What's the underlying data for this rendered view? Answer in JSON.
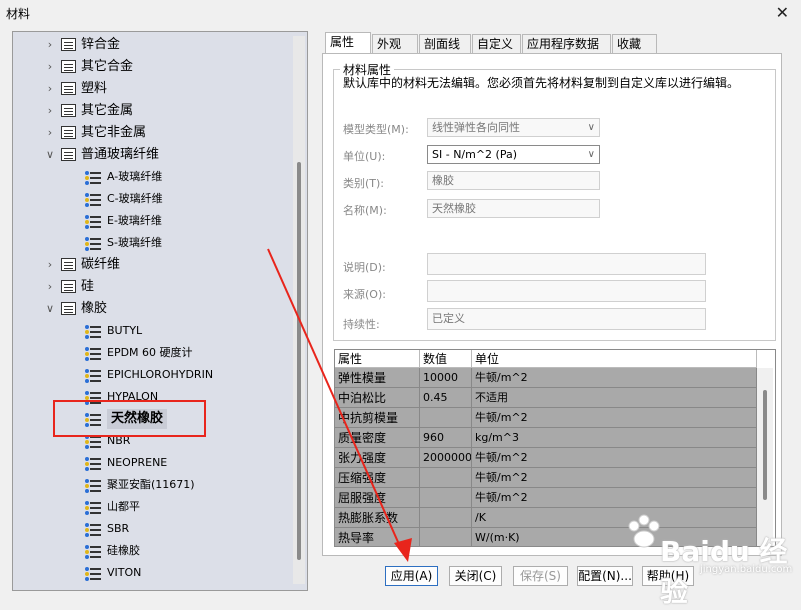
{
  "window": {
    "title": "材料",
    "close_glyph": "✕"
  },
  "tree": {
    "folders": [
      {
        "label": "锌合金",
        "expanded": false
      },
      {
        "label": "其它合金",
        "expanded": false
      },
      {
        "label": "塑料",
        "expanded": false
      },
      {
        "label": "其它金属",
        "expanded": false
      },
      {
        "label": "其它非金属",
        "expanded": false
      },
      {
        "label": "普通玻璃纤维",
        "expanded": true
      },
      {
        "label": "碳纤维",
        "expanded": false
      },
      {
        "label": "硅",
        "expanded": false
      },
      {
        "label": "橡胶",
        "expanded": true
      }
    ],
    "glass_materials": [
      "A-玻璃纤维",
      "C-玻璃纤维",
      "E-玻璃纤维",
      "S-玻璃纤维"
    ],
    "rubber_materials": [
      "BUTYL",
      "EPDM 60 硬度计",
      "EPICHLOROHYDRIN",
      "HYPALON",
      "天然橡胶",
      "NBR",
      "NEOPRENE",
      "聚亚安酯(11671)",
      "山都平",
      "SBR",
      "硅橡胶",
      "VITON"
    ],
    "selected": "天然橡胶",
    "collapse_glyph": "∨",
    "expand_glyph": "›"
  },
  "tabs": [
    "属性",
    "外观",
    "剖面线",
    "自定义",
    "应用程序数据",
    "收藏"
  ],
  "active_tab": "属性",
  "props": {
    "group_title": "材料属性",
    "notice": "默认库中的材料无法编辑。您必须首先将材料复制到自定义库以进行编辑。",
    "model_type_label": "模型类型(M):",
    "model_type_value": "线性弹性各向同性",
    "unit_label": "单位(U):",
    "unit_value": "SI - N/m^2 (Pa)",
    "category_label": "类别(T):",
    "category_value": "橡胶",
    "name_label": "名称(M):",
    "name_value": "天然橡胶",
    "desc_label": "说明(D):",
    "desc_value": "",
    "source_label": "来源(O):",
    "source_value": "",
    "sustain_label": "持续性:",
    "sustain_value": "已定义",
    "dropdown_glyph": "∨"
  },
  "grid": {
    "columns": [
      "属性",
      "数值",
      "单位"
    ],
    "rows": [
      [
        "弹性模量",
        "10000",
        "牛顿/m^2"
      ],
      [
        "中泊松比",
        "0.45",
        "不适用"
      ],
      [
        "中抗剪模量",
        "",
        "牛顿/m^2"
      ],
      [
        "质量密度",
        "960",
        "kg/m^3"
      ],
      [
        "张力强度",
        "20000000",
        "牛顿/m^2"
      ],
      [
        "压缩强度",
        "",
        "牛顿/m^2"
      ],
      [
        "屈服强度",
        "",
        "牛顿/m^2"
      ],
      [
        "热膨胀系数",
        "",
        "/K"
      ],
      [
        "热导率",
        "",
        "W/(m·K)"
      ]
    ]
  },
  "buttons": {
    "apply": "应用(A)",
    "close": "关闭(C)",
    "save": "保存(S)",
    "config": "配置(N)...",
    "help": "帮助(H)"
  },
  "annotation": {
    "color": "#e8251c"
  },
  "watermark": {
    "brand": "Baidu 经验",
    "sub": "jingyan.baidu.com"
  }
}
